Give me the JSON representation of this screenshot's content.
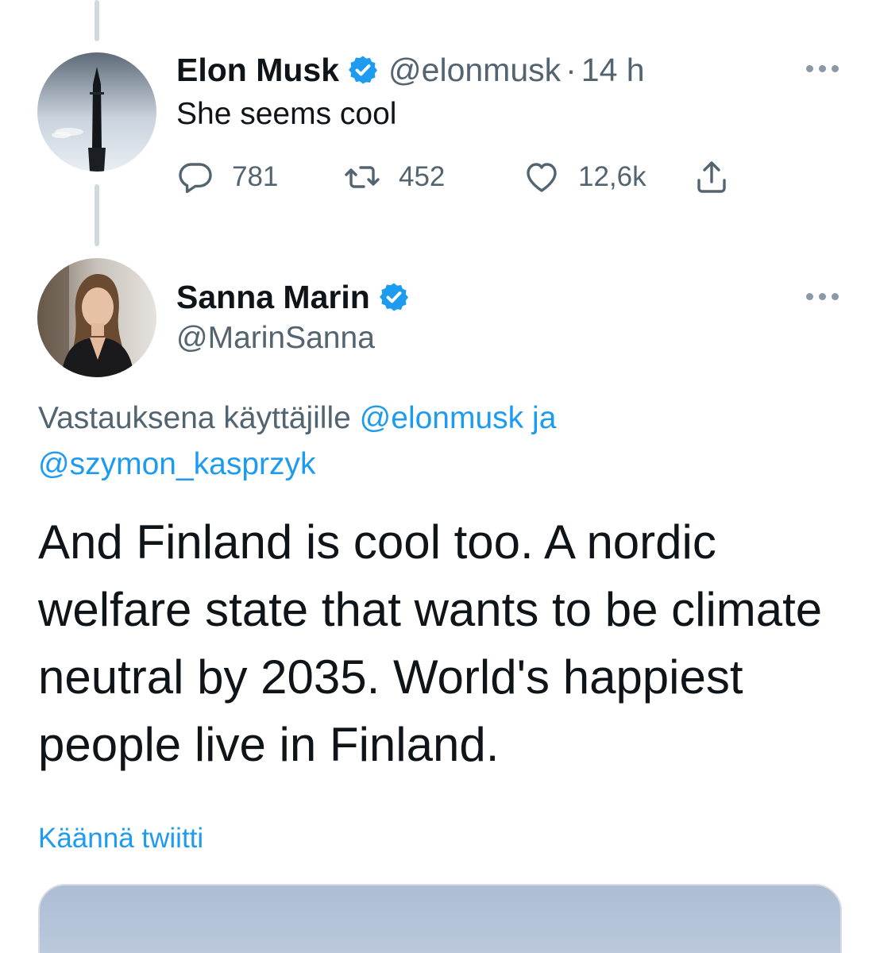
{
  "tweet1": {
    "display_name": "Elon Musk",
    "handle": "@elonmusk",
    "separator": "·",
    "time": "14 h",
    "text": "She seems cool",
    "actions": {
      "replies": "781",
      "retweets": "452",
      "likes": "12,6k"
    }
  },
  "tweet2": {
    "display_name": "Sanna Marin",
    "handle": "@MarinSanna",
    "reply_prefix": "Vastauksena käyttäjille ",
    "reply_mention_1": "@elonmusk",
    "reply_joiner": " ja",
    "reply_mention_2": "@szymon_kasprzyk",
    "body": "And Finland is cool too. A nordic welfare state that wants to be climate neutral by 2035. World's happiest people live in Finland.",
    "translate_link": "Käännä twiitti"
  },
  "colors": {
    "accent": "#1d9bf0",
    "secondary_text": "#536471",
    "primary_text": "#0f1419"
  },
  "icons": {
    "verified": "verified-badge-icon",
    "reply": "reply-icon",
    "retweet": "retweet-icon",
    "like": "heart-icon",
    "share": "share-icon",
    "more": "more-icon"
  }
}
